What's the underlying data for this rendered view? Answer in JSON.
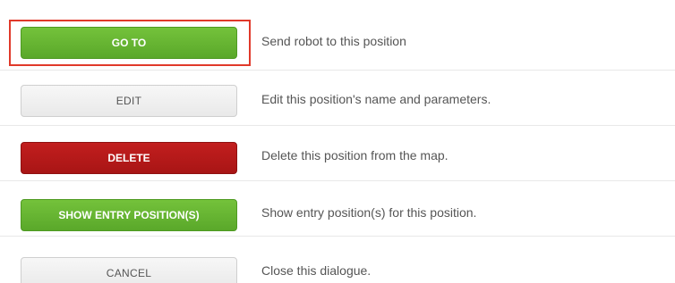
{
  "actions": [
    {
      "button_label": "GO TO",
      "description": "Send robot to this position",
      "style": "green"
    },
    {
      "button_label": "EDIT",
      "description": "Edit this position's name and parameters.",
      "style": "grey"
    },
    {
      "button_label": "DELETE",
      "description": "Delete this position from the map.",
      "style": "red"
    },
    {
      "button_label": "SHOW ENTRY POSITION(S)",
      "description": "Show entry position(s) for this position.",
      "style": "green"
    },
    {
      "button_label": "CANCEL",
      "description": "Close this dialogue.",
      "style": "grey"
    }
  ],
  "highlight": {
    "target": "GO TO",
    "color": "#e0392a"
  },
  "colors": {
    "green": "#5aa82a",
    "red": "#b01818",
    "grey": "#ececec",
    "text": "#555555"
  }
}
